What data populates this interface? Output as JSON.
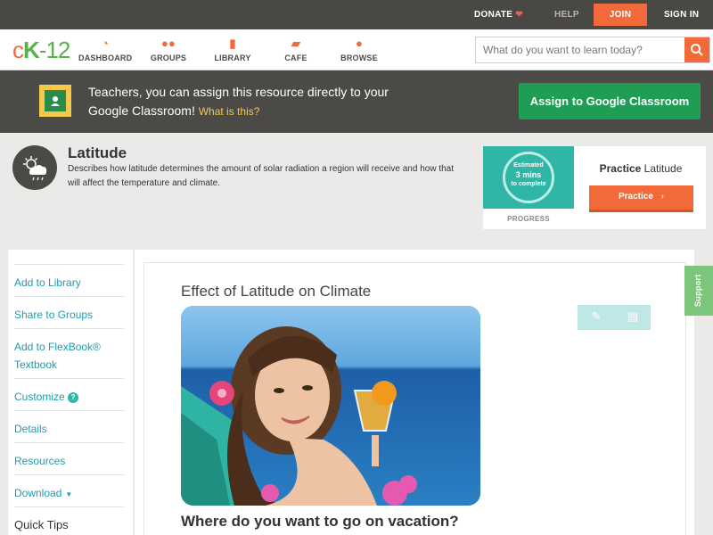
{
  "topbar": {
    "donate": "DONATE",
    "help": "HELP",
    "join": "JOIN",
    "sign_in": "SIGN IN"
  },
  "nav": {
    "logo_c": "c",
    "logo_k": "K",
    "logo_12": "-12",
    "items": [
      {
        "label": "DASHBOARD",
        "icon": "gauge-icon"
      },
      {
        "label": "GROUPS",
        "icon": "people-icon"
      },
      {
        "label": "LIBRARY",
        "icon": "book-icon"
      },
      {
        "label": "CAFE",
        "icon": "chat-icon"
      },
      {
        "label": "BROWSE",
        "icon": "lightbulb-icon"
      }
    ],
    "search_placeholder": "What do you want to learn today?"
  },
  "classroom_banner": {
    "text": "Teachers, you can assign this resource directly to your Google Classroom!",
    "link": "What is this?",
    "button": "Assign to Google Classroom"
  },
  "concept": {
    "title": "Latitude",
    "description": "Describes how latitude determines the amount of solar radiation a region will receive and how that will affect the temperature and climate."
  },
  "practice": {
    "estimated": "Estimated",
    "mins": "3 mins",
    "to_complete": "to complete",
    "progress_label": "PROGRESS",
    "heading_bold": "Practice",
    "heading_rest": "Latitude",
    "button": "Practice"
  },
  "sidebar": {
    "items": [
      "Add to Library",
      "Share to Groups",
      "Add to FlexBook® Textbook",
      "Customize",
      "Details",
      "Resources",
      "Download"
    ],
    "quick_tips": "Quick Tips"
  },
  "content": {
    "title": "Effect of Latitude on Climate",
    "question": "Where do you want to go on vacation?"
  },
  "support": "Support",
  "colors": {
    "brand_orange": "#f26a3a",
    "brand_green": "#5ab04a",
    "classroom_green": "#1f9d55",
    "link_teal": "#1f9bb0"
  }
}
